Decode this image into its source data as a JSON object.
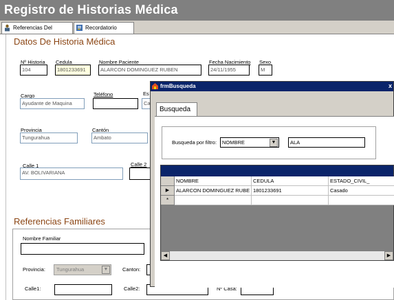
{
  "app": {
    "title": "Registro de Historias Médica"
  },
  "tabs": [
    {
      "label": "Referencias Del Personal"
    },
    {
      "label": "Recordatorio Clínico"
    }
  ],
  "datos": {
    "heading": "Datos De Historia Médica",
    "historia": {
      "label": "Nº Historia",
      "value": "104"
    },
    "cedula": {
      "label": "Cedula",
      "value": "1801233691"
    },
    "nombre": {
      "label": "Nombre Paciente",
      "value": "ALARCON DOMINGUEZ RUBEN"
    },
    "fecha": {
      "label": "Fecha Nacimiento",
      "value": "24/11/1955"
    },
    "sexo": {
      "label": "Sexo",
      "value": "M"
    },
    "cargo": {
      "label": "Cargo",
      "value": "Ayudante de Maquina"
    },
    "telefono": {
      "label": "Teléfono",
      "value": ""
    },
    "es_label": "Es",
    "ca_value": "Ca",
    "provincia": {
      "label": "Provincia",
      "value": "Tungurahua"
    },
    "canton": {
      "label": "Cantón",
      "value": "Ambato"
    },
    "calle1": {
      "label": "Calle 1",
      "value": "AV. BOLIVARIANA"
    },
    "calle2": {
      "label": "Calle 2",
      "value": ""
    }
  },
  "familiares": {
    "heading": "Referencias Familiares",
    "nombre_label": "Nombre Familiar",
    "nombre_value": "",
    "provincia_label": "Provincia:",
    "provincia_value": "Tungurahua",
    "canton_label": "Canton:",
    "calle1_label": "Calle1:",
    "calle2_label": "Calle2:",
    "nocasa_label": "Nº Casa:"
  },
  "modal": {
    "title": "frmBusqueda",
    "tab": "Busqueda",
    "filter_label": "Busqueda por filtro:",
    "filter_value": "NOMBRE",
    "search_value": "ALA",
    "columns": [
      "NOMBRE",
      "CEDULA",
      "ESTADO_CIVIL_"
    ],
    "rows": [
      {
        "marker": "▶",
        "cells": [
          "ALARCON DOMINGUEZ RUBE",
          "1801233691",
          "Casado"
        ]
      },
      {
        "marker": "*",
        "cells": [
          "",
          "",
          ""
        ]
      }
    ]
  },
  "colors": {
    "accent_heading": "#8b4513",
    "titlebar": "#808080",
    "grid_header": "#0a246a"
  },
  "icons": [
    "person-icon",
    "notes-icon",
    "window-icon",
    "dropdown-arrow-icon",
    "scroll-left-icon",
    "scroll-right-icon",
    "row-pointer-icon"
  ]
}
